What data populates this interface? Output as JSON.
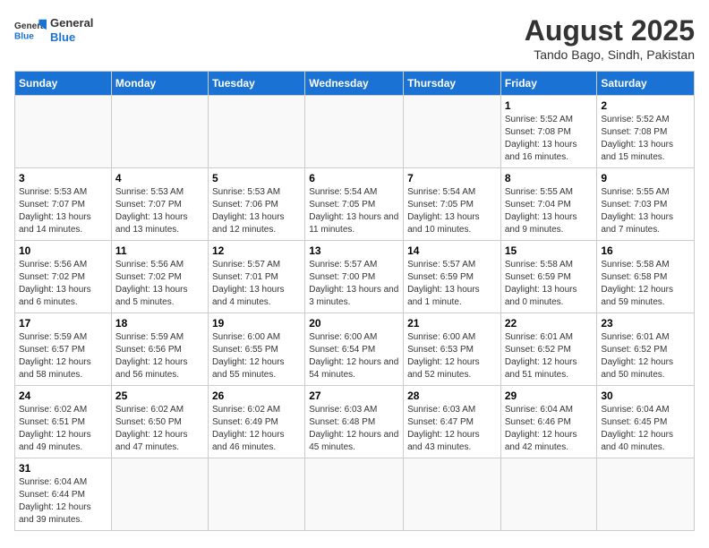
{
  "header": {
    "logo_general": "General",
    "logo_blue": "Blue",
    "month_title": "August 2025",
    "location": "Tando Bago, Sindh, Pakistan"
  },
  "days_of_week": [
    "Sunday",
    "Monday",
    "Tuesday",
    "Wednesday",
    "Thursday",
    "Friday",
    "Saturday"
  ],
  "weeks": [
    [
      {
        "day": "",
        "info": ""
      },
      {
        "day": "",
        "info": ""
      },
      {
        "day": "",
        "info": ""
      },
      {
        "day": "",
        "info": ""
      },
      {
        "day": "",
        "info": ""
      },
      {
        "day": "1",
        "info": "Sunrise: 5:52 AM\nSunset: 7:08 PM\nDaylight: 13 hours and 16 minutes."
      },
      {
        "day": "2",
        "info": "Sunrise: 5:52 AM\nSunset: 7:08 PM\nDaylight: 13 hours and 15 minutes."
      }
    ],
    [
      {
        "day": "3",
        "info": "Sunrise: 5:53 AM\nSunset: 7:07 PM\nDaylight: 13 hours and 14 minutes."
      },
      {
        "day": "4",
        "info": "Sunrise: 5:53 AM\nSunset: 7:07 PM\nDaylight: 13 hours and 13 minutes."
      },
      {
        "day": "5",
        "info": "Sunrise: 5:53 AM\nSunset: 7:06 PM\nDaylight: 13 hours and 12 minutes."
      },
      {
        "day": "6",
        "info": "Sunrise: 5:54 AM\nSunset: 7:05 PM\nDaylight: 13 hours and 11 minutes."
      },
      {
        "day": "7",
        "info": "Sunrise: 5:54 AM\nSunset: 7:05 PM\nDaylight: 13 hours and 10 minutes."
      },
      {
        "day": "8",
        "info": "Sunrise: 5:55 AM\nSunset: 7:04 PM\nDaylight: 13 hours and 9 minutes."
      },
      {
        "day": "9",
        "info": "Sunrise: 5:55 AM\nSunset: 7:03 PM\nDaylight: 13 hours and 7 minutes."
      }
    ],
    [
      {
        "day": "10",
        "info": "Sunrise: 5:56 AM\nSunset: 7:02 PM\nDaylight: 13 hours and 6 minutes."
      },
      {
        "day": "11",
        "info": "Sunrise: 5:56 AM\nSunset: 7:02 PM\nDaylight: 13 hours and 5 minutes."
      },
      {
        "day": "12",
        "info": "Sunrise: 5:57 AM\nSunset: 7:01 PM\nDaylight: 13 hours and 4 minutes."
      },
      {
        "day": "13",
        "info": "Sunrise: 5:57 AM\nSunset: 7:00 PM\nDaylight: 13 hours and 3 minutes."
      },
      {
        "day": "14",
        "info": "Sunrise: 5:57 AM\nSunset: 6:59 PM\nDaylight: 13 hours and 1 minute."
      },
      {
        "day": "15",
        "info": "Sunrise: 5:58 AM\nSunset: 6:59 PM\nDaylight: 13 hours and 0 minutes."
      },
      {
        "day": "16",
        "info": "Sunrise: 5:58 AM\nSunset: 6:58 PM\nDaylight: 12 hours and 59 minutes."
      }
    ],
    [
      {
        "day": "17",
        "info": "Sunrise: 5:59 AM\nSunset: 6:57 PM\nDaylight: 12 hours and 58 minutes."
      },
      {
        "day": "18",
        "info": "Sunrise: 5:59 AM\nSunset: 6:56 PM\nDaylight: 12 hours and 56 minutes."
      },
      {
        "day": "19",
        "info": "Sunrise: 6:00 AM\nSunset: 6:55 PM\nDaylight: 12 hours and 55 minutes."
      },
      {
        "day": "20",
        "info": "Sunrise: 6:00 AM\nSunset: 6:54 PM\nDaylight: 12 hours and 54 minutes."
      },
      {
        "day": "21",
        "info": "Sunrise: 6:00 AM\nSunset: 6:53 PM\nDaylight: 12 hours and 52 minutes."
      },
      {
        "day": "22",
        "info": "Sunrise: 6:01 AM\nSunset: 6:52 PM\nDaylight: 12 hours and 51 minutes."
      },
      {
        "day": "23",
        "info": "Sunrise: 6:01 AM\nSunset: 6:52 PM\nDaylight: 12 hours and 50 minutes."
      }
    ],
    [
      {
        "day": "24",
        "info": "Sunrise: 6:02 AM\nSunset: 6:51 PM\nDaylight: 12 hours and 49 minutes."
      },
      {
        "day": "25",
        "info": "Sunrise: 6:02 AM\nSunset: 6:50 PM\nDaylight: 12 hours and 47 minutes."
      },
      {
        "day": "26",
        "info": "Sunrise: 6:02 AM\nSunset: 6:49 PM\nDaylight: 12 hours and 46 minutes."
      },
      {
        "day": "27",
        "info": "Sunrise: 6:03 AM\nSunset: 6:48 PM\nDaylight: 12 hours and 45 minutes."
      },
      {
        "day": "28",
        "info": "Sunrise: 6:03 AM\nSunset: 6:47 PM\nDaylight: 12 hours and 43 minutes."
      },
      {
        "day": "29",
        "info": "Sunrise: 6:04 AM\nSunset: 6:46 PM\nDaylight: 12 hours and 42 minutes."
      },
      {
        "day": "30",
        "info": "Sunrise: 6:04 AM\nSunset: 6:45 PM\nDaylight: 12 hours and 40 minutes."
      }
    ],
    [
      {
        "day": "31",
        "info": "Sunrise: 6:04 AM\nSunset: 6:44 PM\nDaylight: 12 hours and 39 minutes."
      },
      {
        "day": "",
        "info": ""
      },
      {
        "day": "",
        "info": ""
      },
      {
        "day": "",
        "info": ""
      },
      {
        "day": "",
        "info": ""
      },
      {
        "day": "",
        "info": ""
      },
      {
        "day": "",
        "info": ""
      }
    ]
  ]
}
